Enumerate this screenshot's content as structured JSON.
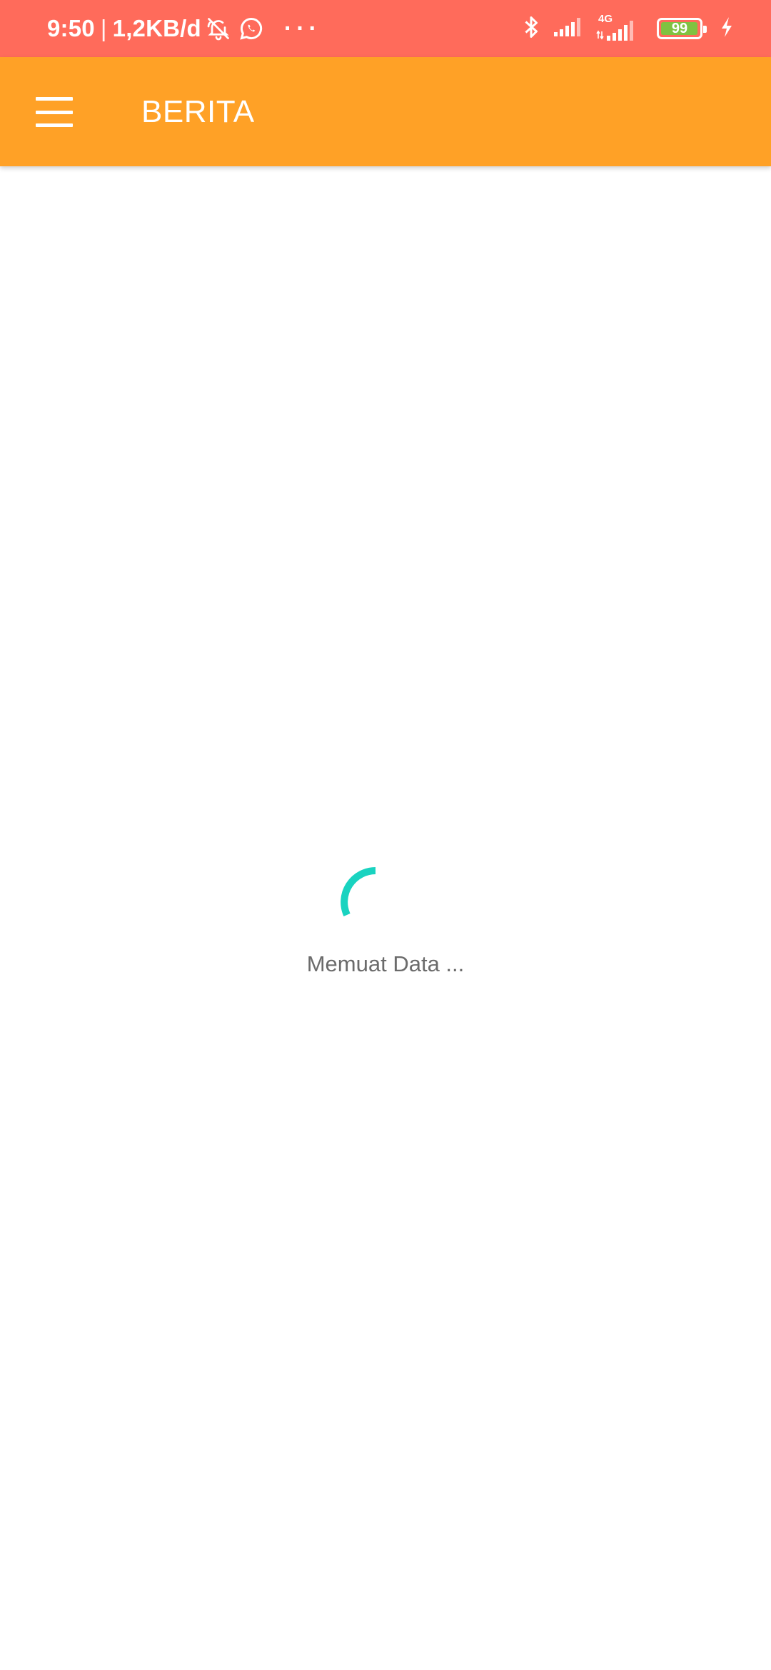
{
  "status_bar": {
    "time": "9:50",
    "separator": "|",
    "network_speed": "1,2KB/d",
    "icons_left": [
      "notifications-off-icon",
      "whatsapp-icon",
      "more-dots-icon"
    ],
    "dots": "···",
    "icons_right": [
      "bluetooth-icon",
      "signal-icon",
      "4g-signal-icon",
      "battery-icon",
      "charging-icon"
    ],
    "network_type": "4G",
    "battery_level": "99",
    "battery_fraction": 0.99,
    "colors": {
      "background": "#ff6b5b",
      "battery_fill": "#7fc241"
    }
  },
  "app_bar": {
    "title": "BERITA",
    "menu_icon": "hamburger-menu-icon",
    "background": "#ffa126"
  },
  "loading": {
    "text": "Memuat Data ...",
    "spinner_color": "#19d3c0"
  }
}
